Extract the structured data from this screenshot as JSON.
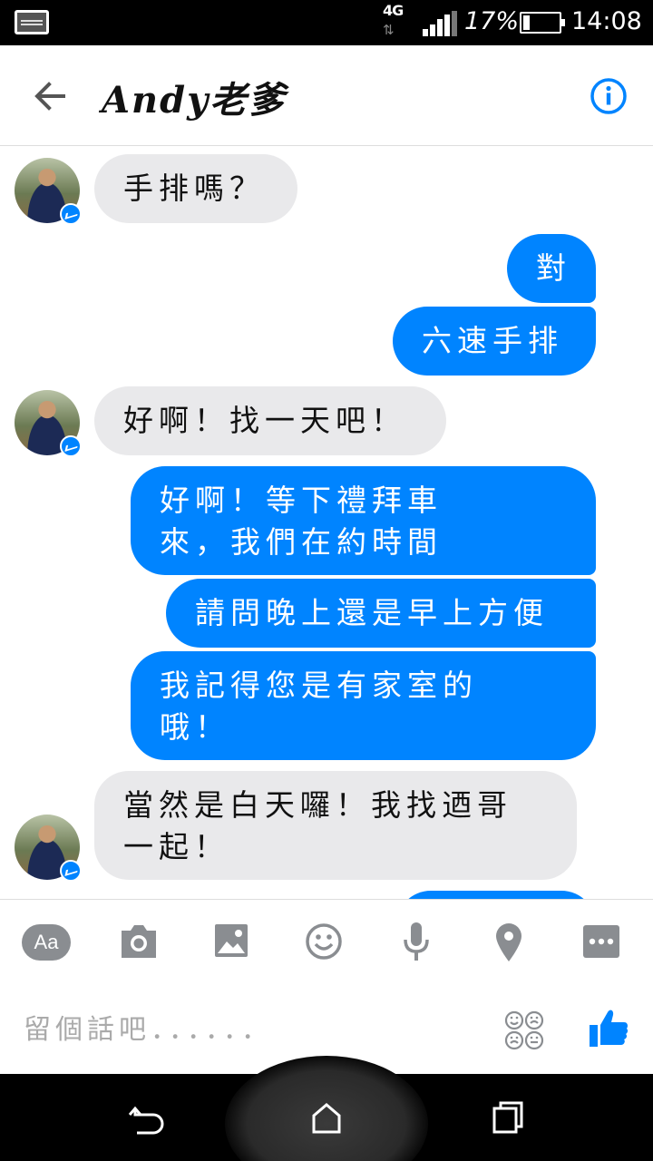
{
  "status_bar": {
    "network": "4G",
    "battery_percent": "17%",
    "battery_level": 0.17,
    "time": "14:08"
  },
  "header": {
    "title": "Andy老爹",
    "back_icon": "arrow-left-icon",
    "info_icon": "info-icon"
  },
  "messages": [
    {
      "sender": "them",
      "text": "手排嗎？"
    },
    {
      "sender": "me",
      "text": "對"
    },
    {
      "sender": "me",
      "text": "六速手排"
    },
    {
      "sender": "them",
      "text": "好啊！找一天吧！"
    },
    {
      "sender": "me",
      "lines": [
        "好啊！等下禮拜車",
        "來，我們在約時間"
      ]
    },
    {
      "sender": "me",
      "text": "請問晚上還是早上方便"
    },
    {
      "sender": "me",
      "lines": [
        "我記得您是有家室的",
        "哦！"
      ]
    },
    {
      "sender": "them",
      "lines": [
        "當然是白天囉！我找迺哥",
        "一起！"
      ]
    }
  ],
  "toolbar": {
    "aa_label": "Aa",
    "icons": [
      "camera-icon",
      "image-icon",
      "emoji-icon",
      "microphone-icon",
      "location-icon",
      "more-icon"
    ]
  },
  "composer": {
    "placeholder": "留個話吧．．．．．．"
  },
  "colors": {
    "accent": "#0084ff",
    "incoming_bubble": "#e9e9eb",
    "icon_gray": "#8a8d91"
  },
  "navbar": {
    "icons": [
      "back-nav-icon",
      "home-nav-icon",
      "recents-nav-icon"
    ]
  }
}
